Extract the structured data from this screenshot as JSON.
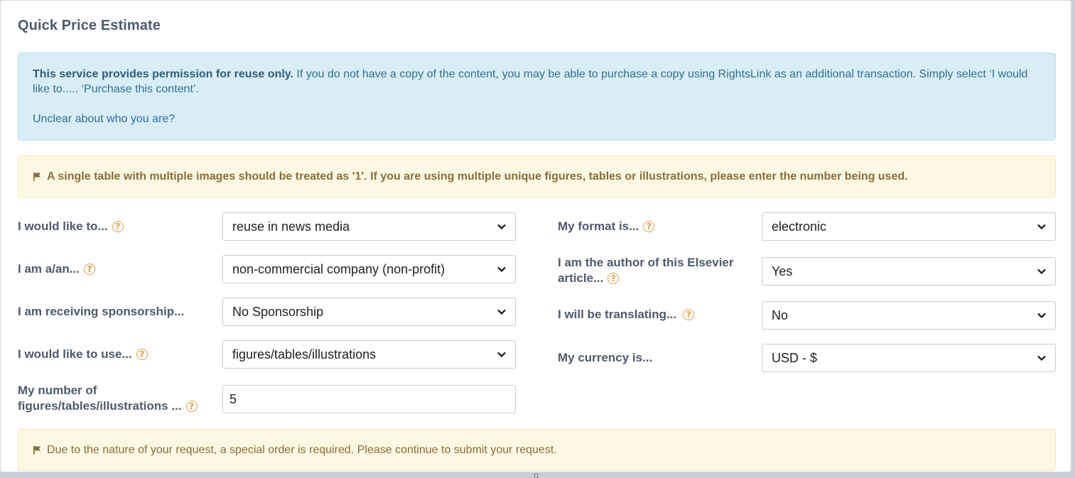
{
  "panel": {
    "title": "Quick Price Estimate"
  },
  "info": {
    "bold": "This service provides permission for reuse only.",
    "text": " If you do not have a copy of the content, you may be able to purchase a copy using RightsLink as an additional transaction. Simply select ‘I would like to..... ‘Purchase this content’.",
    "link_prefix": "Unclear about ",
    "link_text": "who you are?"
  },
  "warnings": {
    "top": "A single table with multiple images should be treated as '1'. If you are using multiple unique figures, tables or illustrations, please enter the number being used.",
    "bottom": "Due to the nature of your request, a special order is required. Please continue to submit your request."
  },
  "form": {
    "would_like_to": {
      "label": "I would like to...",
      "value": "reuse in news media"
    },
    "i_am": {
      "label": "I am a/an...",
      "value": "non-commercial company (non-profit)"
    },
    "sponsorship": {
      "label": "I am receiving sponsorship...",
      "value": "No Sponsorship"
    },
    "would_like_to_use": {
      "label": "I would like to use...",
      "value": "figures/tables/illustrations"
    },
    "number_of": {
      "label_line1": "My number of",
      "label_line2": "figures/tables/illustrations ...",
      "value": "5"
    },
    "format": {
      "label": "My format is...",
      "value": "electronic"
    },
    "author": {
      "label_line1": "I am the author of this Elsevier",
      "label_line2": "article...",
      "value": "Yes"
    },
    "translating": {
      "label": "I will be translating...",
      "value": "No"
    },
    "currency": {
      "label": "My currency is...",
      "value": "USD - $"
    }
  },
  "icons": {
    "help": "question-circle-icon",
    "flag": "flag-icon",
    "chevron": "chevron-down-icon"
  },
  "colors": {
    "info_bg": "#d9edf7",
    "warning_bg": "#fcf8e3",
    "help_icon": "#e09a3c",
    "link": "#2a6fb0"
  }
}
